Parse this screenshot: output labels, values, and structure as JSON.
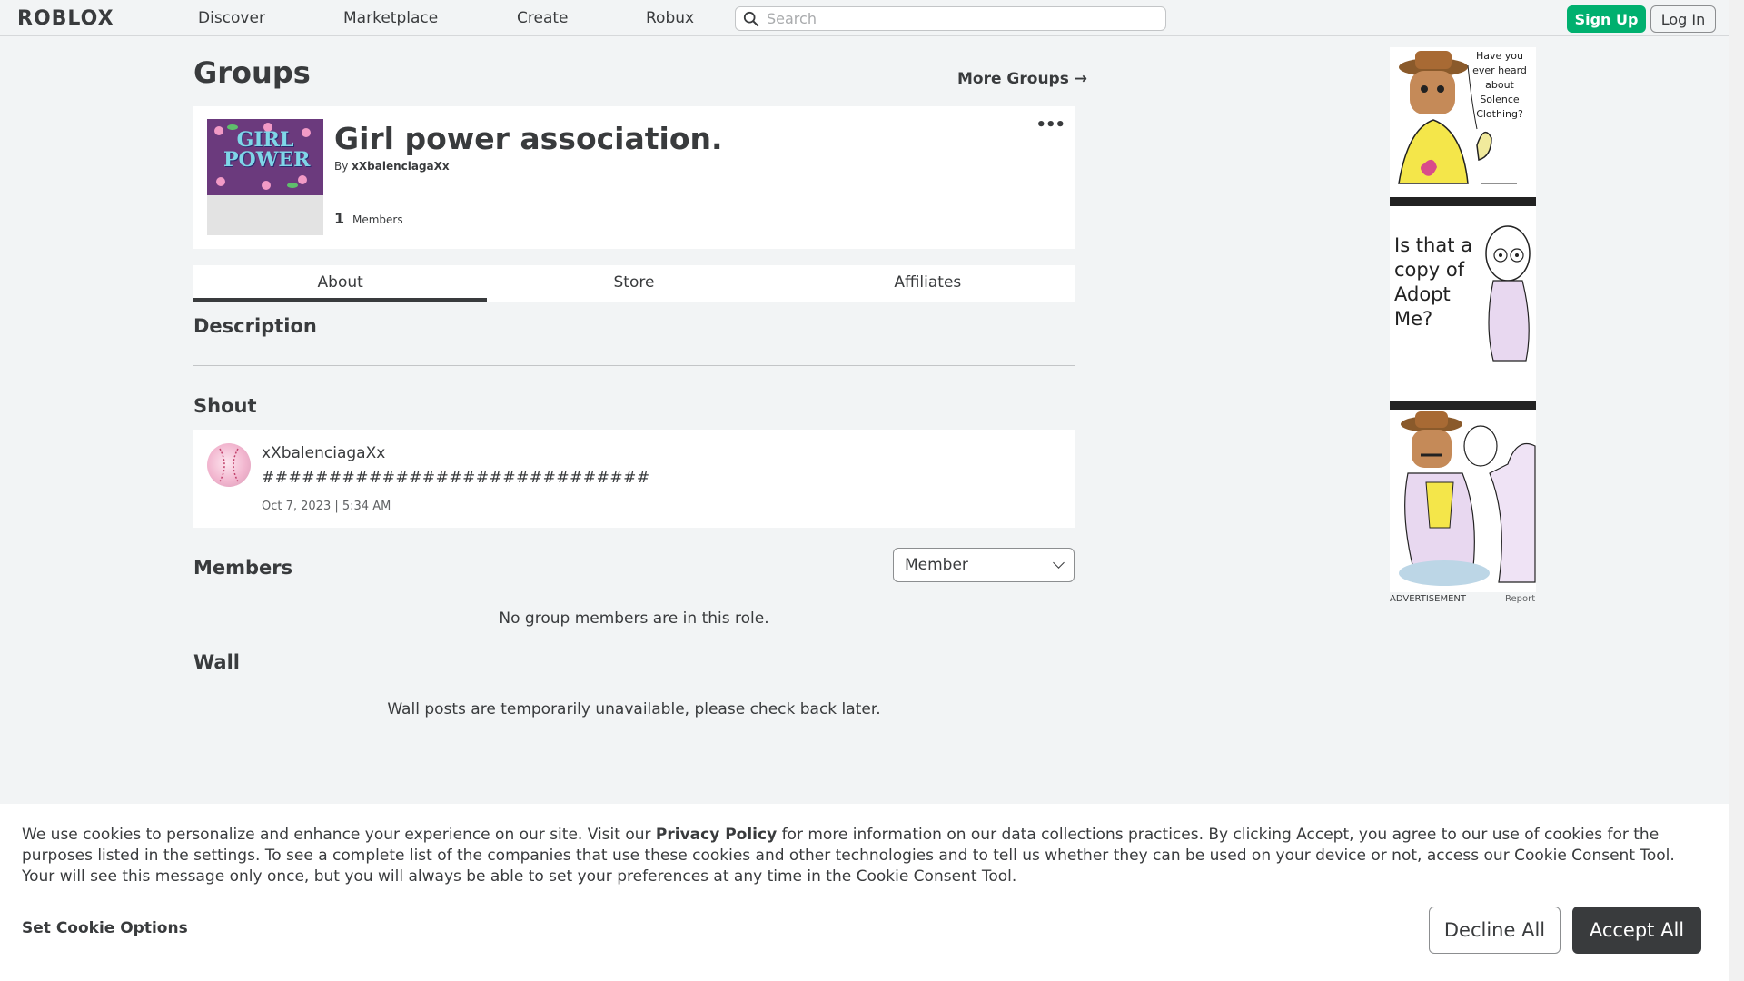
{
  "nav": {
    "logo": "ROBLOX",
    "links": [
      "Discover",
      "Marketplace",
      "Create",
      "Robux"
    ],
    "search_placeholder": "Search",
    "signup": "Sign Up",
    "login": "Log In"
  },
  "page": {
    "title": "Groups",
    "more_groups": "More Groups →"
  },
  "group": {
    "name": "Girl power association.",
    "by_prefix": "By",
    "owner": "xXbalenciagaXx",
    "member_count": "1",
    "members_label": "Members",
    "emblem_text": "GIRL POWER",
    "more_menu": "•••"
  },
  "tabs": [
    "About",
    "Store",
    "Affiliates"
  ],
  "description": {
    "heading": "Description"
  },
  "shout": {
    "heading": "Shout",
    "user": "xXbalenciagaXx",
    "text": "#############################",
    "date": "Oct 7, 2023 | 5:34 AM"
  },
  "members": {
    "heading": "Members",
    "role_selected": "Member",
    "empty": "No group members are in this role."
  },
  "wall": {
    "heading": "Wall",
    "empty": "Wall posts are temporarily unavailable, please check back later."
  },
  "ad": {
    "panel1": "Have you ever heard about Solence Clothing?",
    "panel2": "Is that a copy of Adopt Me?",
    "label": "ADVERTISEMENT",
    "report": "Report"
  },
  "cookie": {
    "text_before": "We use cookies to personalize and enhance your experience on our site. Visit our ",
    "privacy_link": "Privacy Policy",
    "text_after": " for more information on our data collections practices. By clicking Accept, you agree to our use of cookies for the purposes listed in the settings. To see a complete list of the companies that use these cookies and other technologies and to tell us whether they can be used on your device or not, access our Cookie Consent Tool. Your will see this message only once, but you will always be able to set your preferences at any time in the Cookie Consent Tool.",
    "set_options": "Set Cookie Options",
    "decline": "Decline All",
    "accept": "Accept All"
  },
  "colors": {
    "background": "#f2f4f5",
    "accent_green": "#00b06f",
    "text_primary": "#393b3d",
    "accept_button": "#393b3d"
  }
}
